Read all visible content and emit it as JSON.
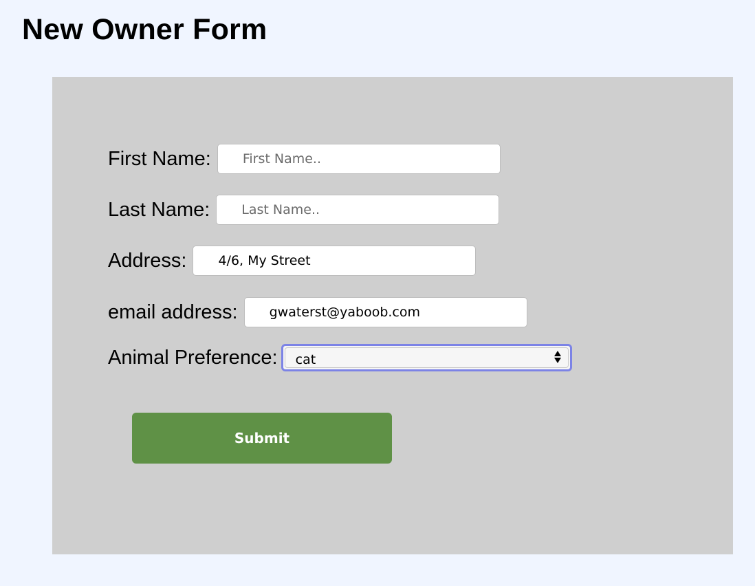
{
  "page": {
    "title": "New Owner Form"
  },
  "form": {
    "first_name": {
      "label": "First Name:",
      "placeholder": "First Name..",
      "value": ""
    },
    "last_name": {
      "label": "Last Name:",
      "placeholder": "Last Name..",
      "value": ""
    },
    "address": {
      "label": "Address:",
      "value": "4/6, My Street"
    },
    "email": {
      "label": "email address:",
      "value": "gwaterst@yaboob.com"
    },
    "animal_preference": {
      "label": "Animal Preference:",
      "selected": "cat"
    },
    "submit_label": "Submit"
  },
  "colors": {
    "page_background": "#f0f5ff",
    "panel_background": "#cfcfcf",
    "submit_background": "#5f9146",
    "focus_ring": "#7c83e6"
  }
}
